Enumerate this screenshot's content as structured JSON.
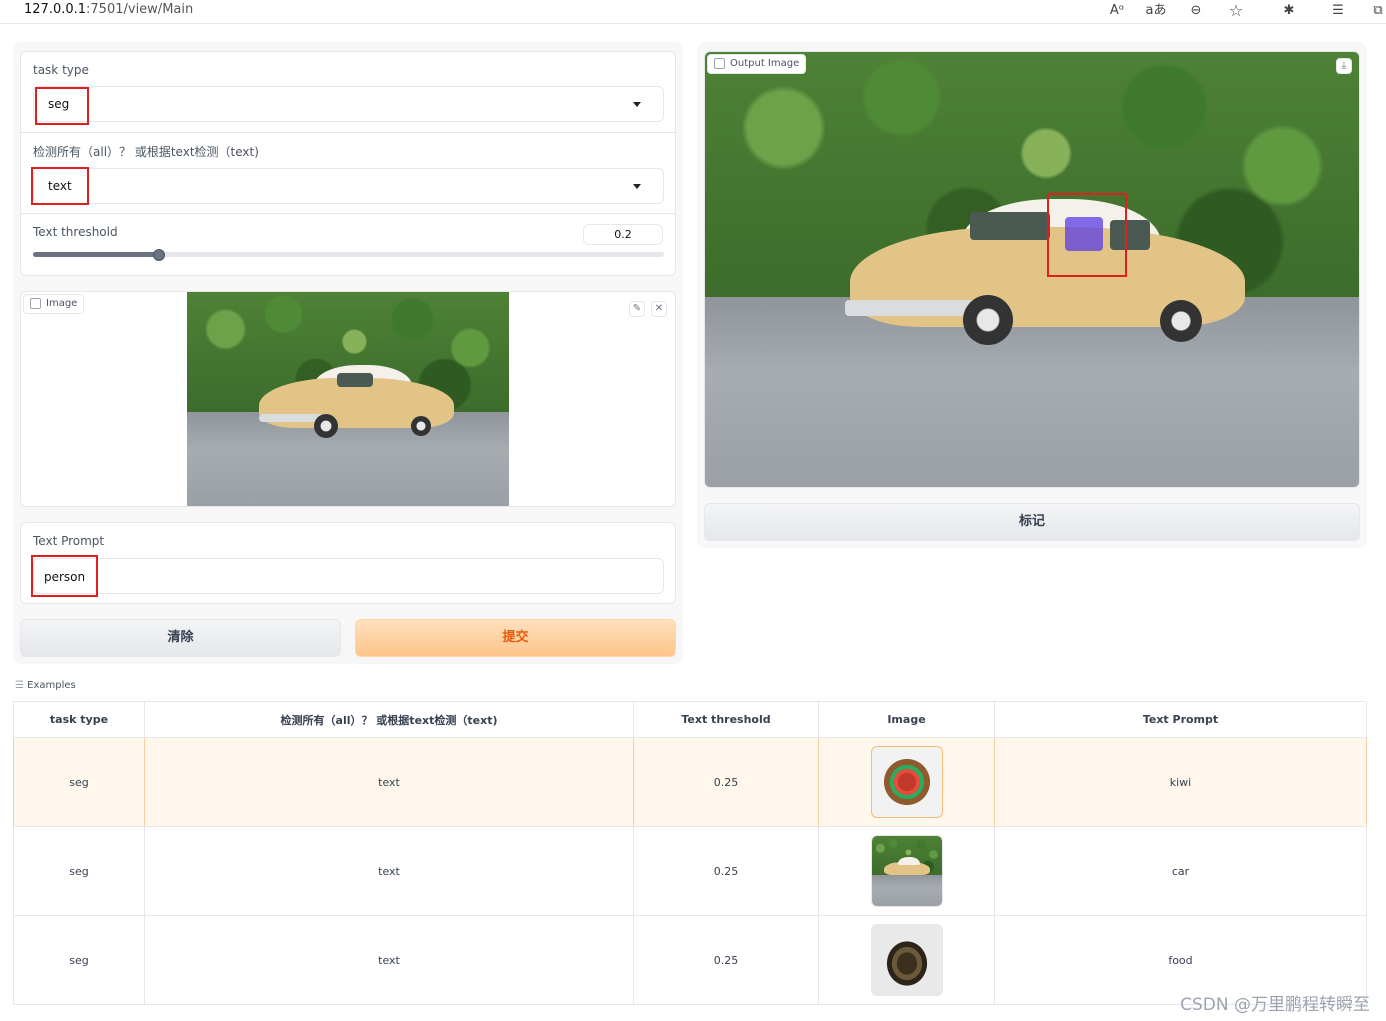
{
  "browser": {
    "url_host": "127.0.0.1",
    "url_path": ":7501/view/Main",
    "icons": [
      "read-aloud-icon",
      "translate-icon",
      "zoom-out-icon",
      "favorite-icon",
      "extensions-icon",
      "favorites-icon",
      "collections-icon"
    ],
    "icon_glyphs": [
      "Aᵅ",
      "aあ",
      "⊖",
      "☆",
      "✱",
      "☰",
      "⧉"
    ]
  },
  "controls": {
    "task_type": {
      "label": "task type",
      "value": "seg"
    },
    "detect_mode": {
      "label": "检测所有（all）？ 或根据text检测（text)",
      "value": "text"
    },
    "text_threshold": {
      "label": "Text threshold",
      "value": "0.2",
      "fraction": 0.2
    },
    "image": {
      "badge": "Image",
      "edit_glyph": "✎",
      "clear_glyph": "✕"
    },
    "text_prompt": {
      "label": "Text Prompt",
      "value": "person"
    },
    "clear_button": "清除",
    "submit_button": "提交"
  },
  "output": {
    "badge": "Output Image",
    "download_glyph": "⤓",
    "mark_button": "标记"
  },
  "examples": {
    "title": "Examples",
    "headers": [
      "task type",
      "检测所有（all）？ 或根据text检测（text)",
      "Text threshold",
      "Image",
      "Text Prompt"
    ],
    "rows": [
      {
        "task_type": "seg",
        "mode": "text",
        "threshold": "0.25",
        "image": "fruit",
        "prompt": "kiwi"
      },
      {
        "task_type": "seg",
        "mode": "text",
        "threshold": "0.25",
        "image": "car",
        "prompt": "car"
      },
      {
        "task_type": "seg",
        "mode": "text",
        "threshold": "0.25",
        "image": "food",
        "prompt": "food"
      }
    ]
  },
  "watermark": "CSDN @万里鹏程转瞬至",
  "colors": {
    "highlight_box": "#e02020",
    "accent_orange": "#ea580c",
    "selected_row": "#fff6ec"
  }
}
